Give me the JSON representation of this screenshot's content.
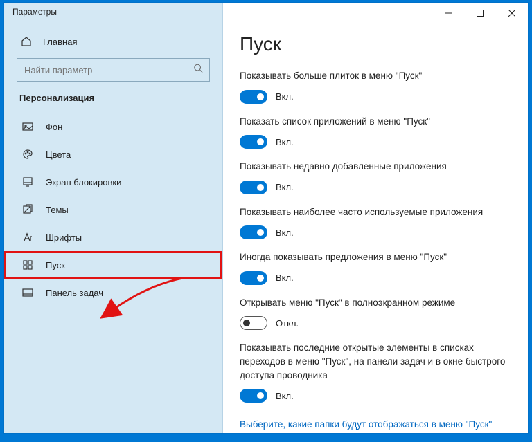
{
  "window": {
    "title": "Параметры"
  },
  "sidebar": {
    "home": "Главная",
    "search_placeholder": "Найти параметр",
    "category": "Персонализация",
    "items": [
      {
        "key": "background",
        "label": "Фон"
      },
      {
        "key": "colors",
        "label": "Цвета"
      },
      {
        "key": "lockscreen",
        "label": "Экран блокировки"
      },
      {
        "key": "themes",
        "label": "Темы"
      },
      {
        "key": "fonts",
        "label": "Шрифты"
      },
      {
        "key": "start",
        "label": "Пуск"
      },
      {
        "key": "taskbar",
        "label": "Панель задач"
      }
    ]
  },
  "page": {
    "title": "Пуск",
    "settings": [
      {
        "label": "Показывать больше плиток в меню \"Пуск\"",
        "on": true
      },
      {
        "label": "Показать список приложений в меню \"Пуск\"",
        "on": true
      },
      {
        "label": "Показывать недавно добавленные приложения",
        "on": true
      },
      {
        "label": "Показывать наиболее часто используемые приложения",
        "on": true
      },
      {
        "label": "Иногда показывать предложения в меню \"Пуск\"",
        "on": true
      },
      {
        "label": "Открывать меню \"Пуск\" в полноэкранном режиме",
        "on": false
      },
      {
        "label": "Показывать последние открытые элементы в списках переходов в меню \"Пуск\", на панели задач и в окне быстрого доступа проводника",
        "on": true
      }
    ],
    "state_on": "Вкл.",
    "state_off": "Откл.",
    "link": "Выберите, какие папки будут отображаться в меню \"Пуск\""
  }
}
